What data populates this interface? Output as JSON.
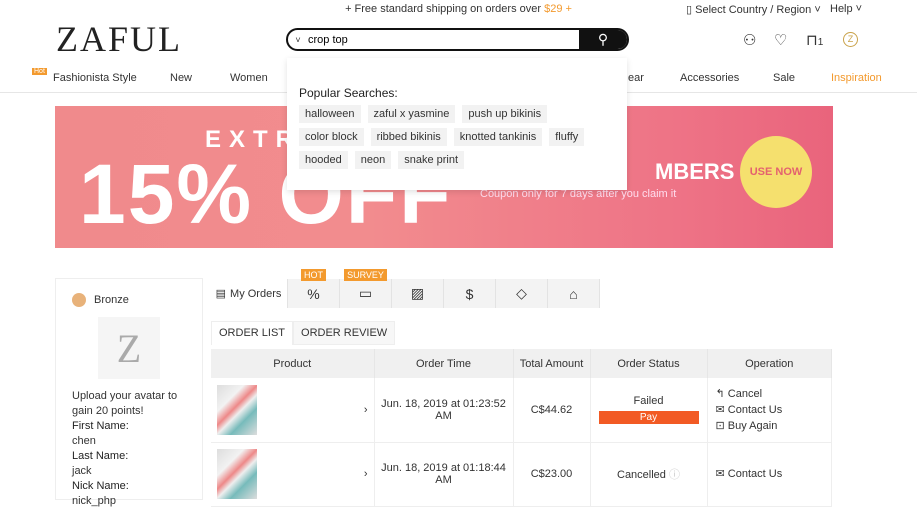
{
  "topbar": {
    "shipping_text": "+ Free standard shipping on orders over ",
    "shipping_price": "$29",
    "shipping_suffix": " +",
    "country": "Select Country / Region",
    "help": "Help"
  },
  "header": {
    "logo": "ZAFUL",
    "search_value": "crop top",
    "cart_count": "1"
  },
  "nav": {
    "hot_badge": "Hot",
    "items": [
      "Fashionista Style",
      "New",
      "Women",
      "ear",
      "Accessories",
      "Sale",
      "Inspiration"
    ],
    "accent": "#f39a2e"
  },
  "dropdown": {
    "title": "Popular Searches:",
    "tags": [
      "halloween",
      "zaful x yasmine",
      "push up bikinis",
      "color block",
      "ribbed bikinis",
      "knotted tankinis",
      "fluffy",
      "hooded",
      "neon",
      "snake print"
    ]
  },
  "banner": {
    "extra": "EXTRA",
    "big": "15% OFF",
    "members": "MBERS",
    "coupon": "Coupon only for 7 days after you claim it",
    "cta": "USE NOW"
  },
  "sidebar": {
    "level": "Bronze",
    "avatar_letter": "Z",
    "upload_text": "Upload your avatar to gain 20 points!",
    "first_name_label": "First Name:",
    "first_name": "chen",
    "last_name_label": "Last Name:",
    "last_name": "jack",
    "nick_name_label": "Nick Name:",
    "nick_name": "nick_php"
  },
  "tabs": {
    "my_orders": "My Orders",
    "hot": "HOT",
    "survey": "SURVEY"
  },
  "subtabs": {
    "order_list": "ORDER LIST",
    "order_review": "ORDER REVIEW"
  },
  "table": {
    "headers": [
      "Product",
      "Order Time",
      "Total Amount",
      "Order Status",
      "Operation"
    ],
    "rows": [
      {
        "time": "Jun. 18, 2019 at 01:23:52 AM",
        "amount": "C$44.62",
        "status": "Failed",
        "pay": "Pay",
        "ops": [
          "Cancel",
          "Contact Us",
          "Buy Again"
        ]
      },
      {
        "time": "Jun. 18, 2019 at 01:18:44 AM",
        "amount": "C$23.00",
        "status": "Cancelled",
        "ops": [
          "Contact Us"
        ]
      }
    ]
  }
}
